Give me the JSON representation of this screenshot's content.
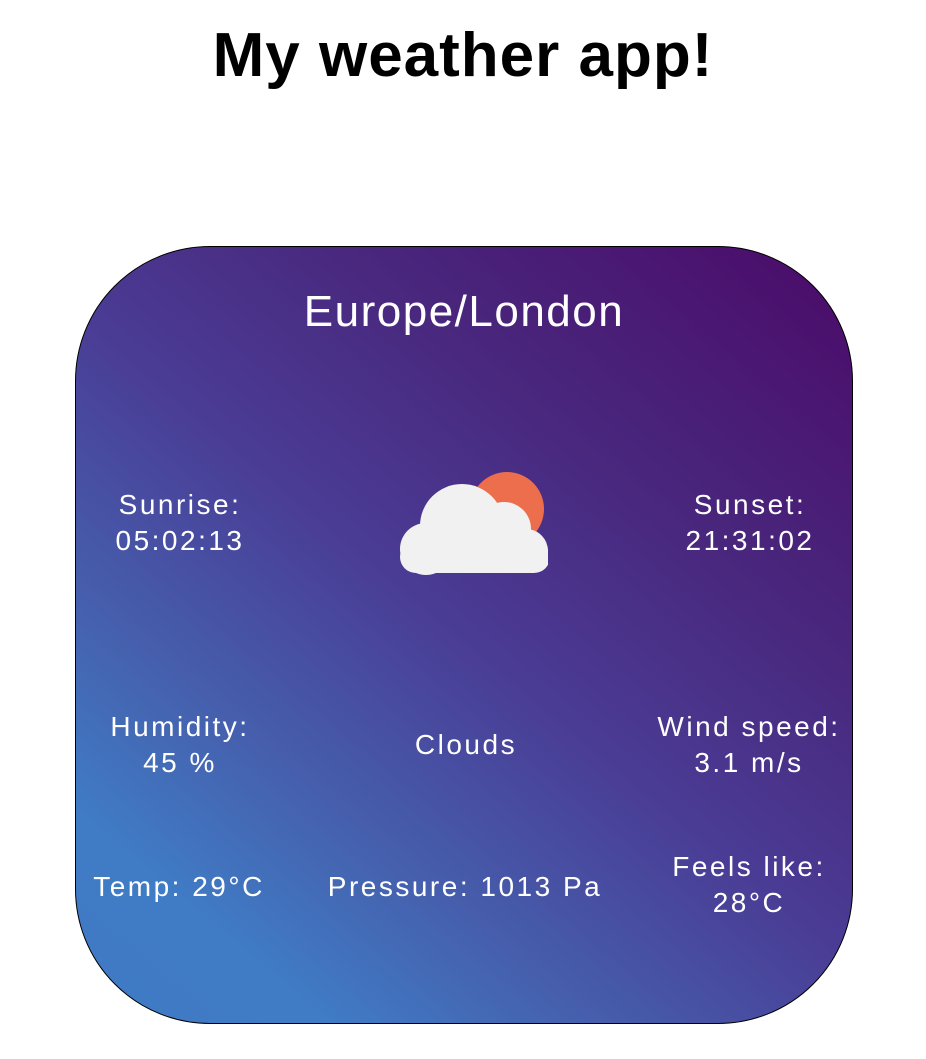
{
  "header": {
    "title": "My weather app!"
  },
  "card": {
    "location": "Europe/London",
    "icon": "partly-cloudy-icon",
    "condition": "Clouds",
    "sunrise": {
      "label": "Sunrise:",
      "value": "05:02:13"
    },
    "sunset": {
      "label": "Sunset:",
      "value": "21:31:02"
    },
    "humidity": {
      "label": "Humidity:",
      "value": "45 %"
    },
    "wind": {
      "label": "Wind speed:",
      "value": "3.1 m/s"
    },
    "temp": "Temp: 29°C",
    "pressure": "Pressure: 1013 Pa",
    "feels_like": {
      "label": "Feels like:",
      "value": "28°C"
    }
  },
  "colors": {
    "gradient_top_right": "#4a0a68",
    "gradient_bottom_left": "#407bc5",
    "sun": "#ec6e4c",
    "cloud": "#f1f1f1"
  }
}
